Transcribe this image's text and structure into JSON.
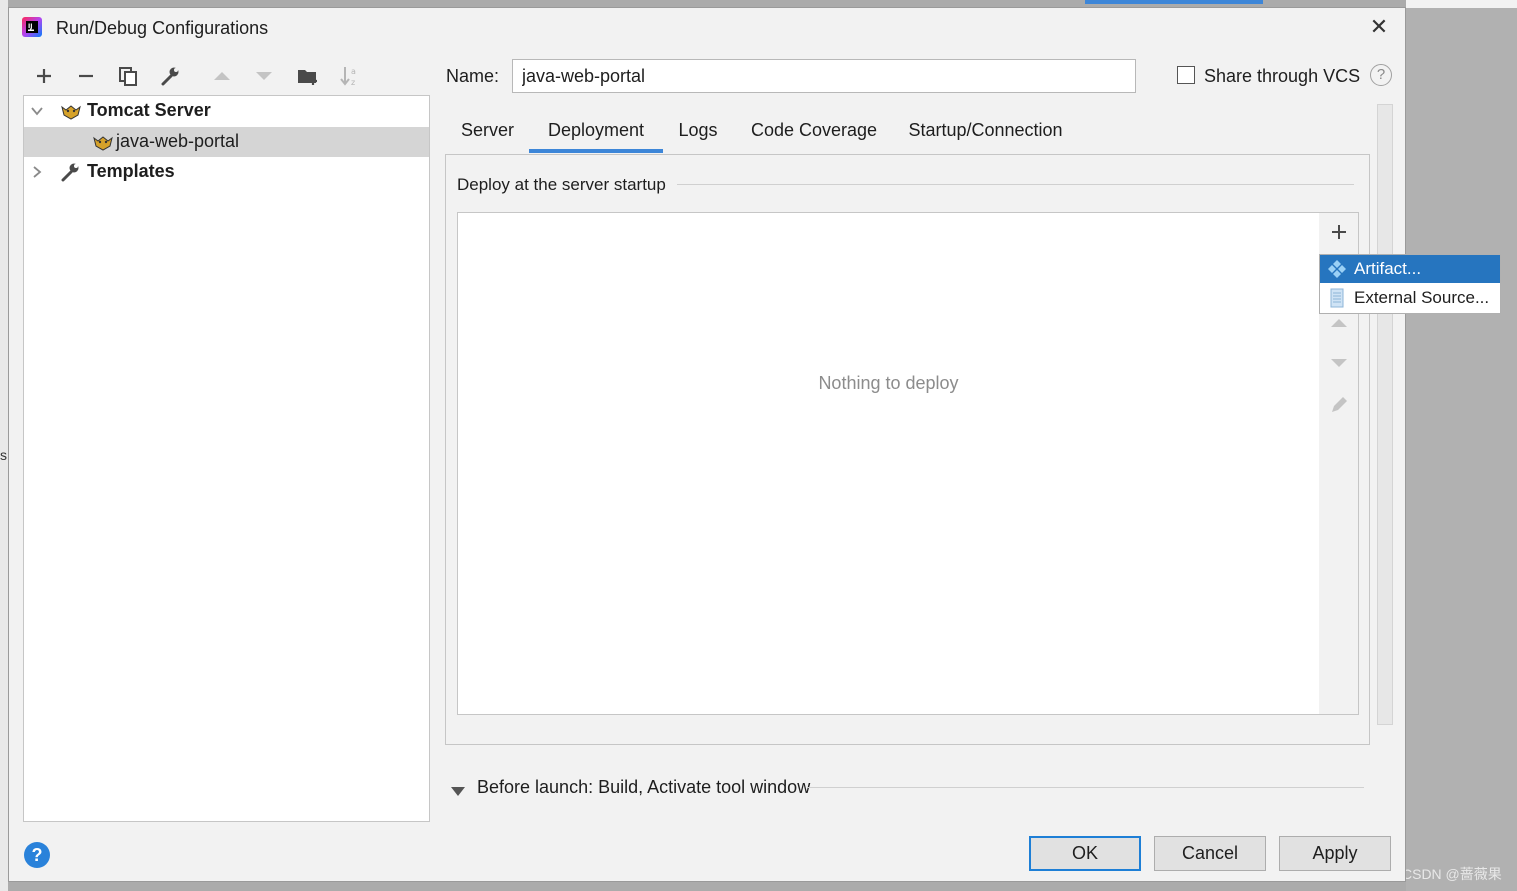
{
  "window": {
    "title": "Run/Debug Configurations",
    "close_glyph": "✕"
  },
  "toolbar": {
    "buttons": [
      "add-icon",
      "remove-icon",
      "copy-icon",
      "wrench-icon",
      "move-up-icon",
      "move-down-icon",
      "new-folder-icon",
      "sort-icon"
    ]
  },
  "tree": {
    "items": [
      {
        "label": "Tomcat Server",
        "icon": "tomcat-icon",
        "expanded": true
      },
      {
        "label": "java-web-portal",
        "icon": "tomcat-icon",
        "selected": true
      },
      {
        "label": "Templates",
        "icon": "wrench-icon",
        "expanded": false
      }
    ]
  },
  "form": {
    "name_label": "Name:",
    "name_value": "java-web-portal",
    "share_label": "Share through VCS",
    "share_checked": false,
    "help_glyph": "?"
  },
  "tabs": [
    {
      "label": "Server"
    },
    {
      "label": "Deployment",
      "active": true
    },
    {
      "label": "Logs"
    },
    {
      "label": "Code Coverage"
    },
    {
      "label": "Startup/Connection"
    }
  ],
  "deployment": {
    "section_title": "Deploy at the server startup",
    "empty_text": "Nothing to deploy"
  },
  "popup": {
    "items": [
      {
        "label": "Artifact...",
        "icon": "artifact-icon",
        "selected": true
      },
      {
        "label": "External Source...",
        "icon": "external-source-icon"
      }
    ]
  },
  "before_launch": {
    "label": "Before launch: Build, Activate tool window"
  },
  "buttons": {
    "ok": "OK",
    "cancel": "Cancel",
    "apply": "Apply",
    "help": "?"
  },
  "background": {
    "edge_letter": "s",
    "watermark": "CSDN @蔷薇果"
  },
  "colors": {
    "accent": "#3d86d8",
    "selection": "#2675bf",
    "tree_selection": "#d5d5d5",
    "dialog_bg": "#f2f2f2"
  }
}
